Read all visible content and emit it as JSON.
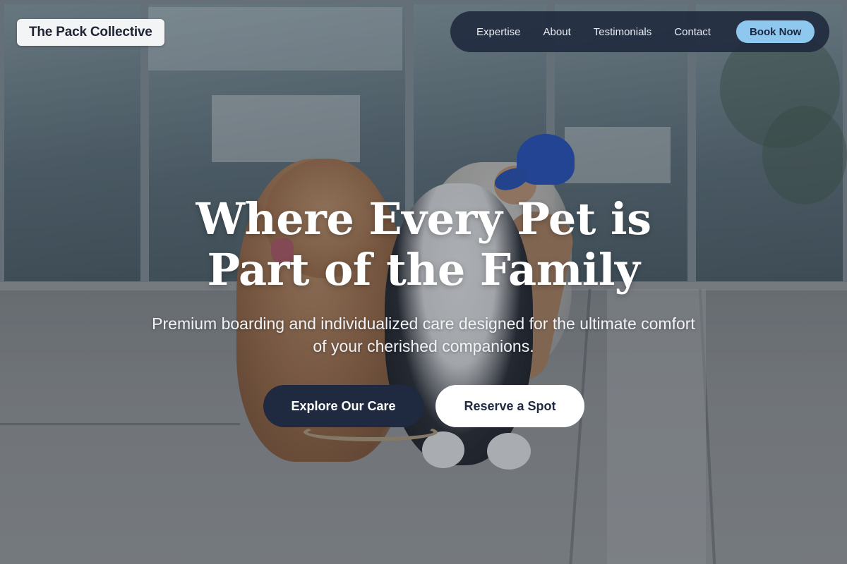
{
  "brand": {
    "name": "The Pack Collective"
  },
  "nav": {
    "links": [
      "Expertise",
      "About",
      "Testimonials",
      "Contact"
    ],
    "cta_label": "Book Now"
  },
  "hero": {
    "headline_line1": "Where Every Pet is",
    "headline_line2": "Part of the Family",
    "subhead_line1": "Premium boarding and individualized care designed for the ultimate comfort",
    "subhead_line2": "of your cherished companions.",
    "primary_cta": "Explore Our Care",
    "secondary_cta": "Reserve a Spot"
  },
  "colors": {
    "nav_background": "#1e283c",
    "book_button": "#8ec8ee",
    "primary_button": "#1f2a40",
    "secondary_button": "#ffffff"
  }
}
